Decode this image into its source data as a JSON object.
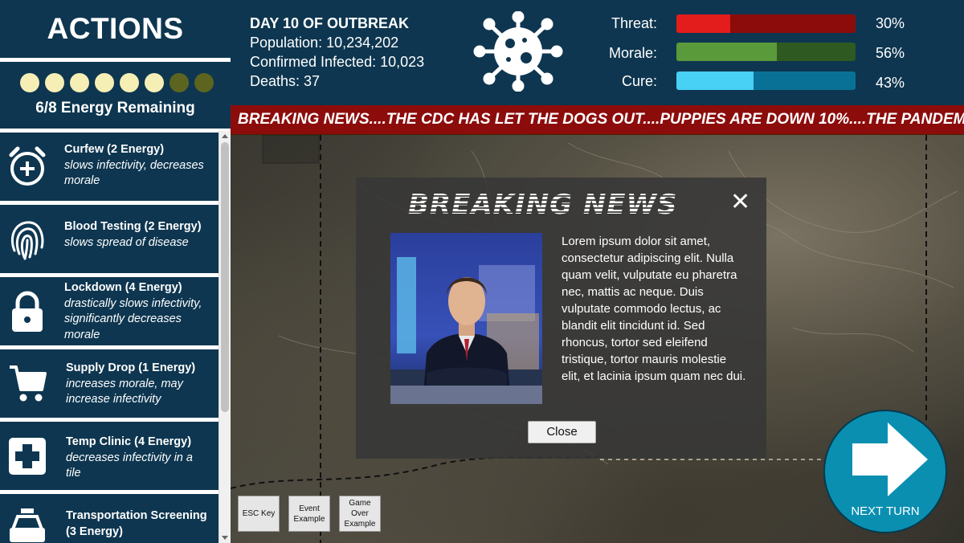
{
  "sidebar": {
    "title": "ACTIONS",
    "energy": {
      "total": 8,
      "remaining": 6,
      "label": "6/8 Energy Remaining"
    },
    "actions": [
      {
        "name": "Curfew (2 Energy)",
        "desc": "slows infectivity, decreases morale",
        "icon": "alarm-clock-plus-icon"
      },
      {
        "name": "Blood Testing (2 Energy)",
        "desc": "slows spread of disease",
        "icon": "fingerprint-icon"
      },
      {
        "name": "Lockdown (4 Energy)",
        "desc": "drastically slows infectivity, significantly decreases morale",
        "icon": "padlock-icon"
      },
      {
        "name": "Supply Drop (1 Energy)",
        "desc": "increases morale, may increase infectivity",
        "icon": "shopping-cart-icon"
      },
      {
        "name": "Temp Clinic (4 Energy)",
        "desc": "decreases infectivity in a tile",
        "icon": "medical-cross-icon"
      },
      {
        "name": "Transportation Screening (3 Energy)",
        "desc": "",
        "icon": "taxi-icon"
      }
    ]
  },
  "topbar": {
    "day": "DAY 10 OF OUTBREAK",
    "population": "Population: 10,234,202",
    "infected": "Confirmed Infected: 10,023",
    "deaths": "Deaths: 37",
    "meters": [
      {
        "label": "Threat:",
        "value": 30,
        "display": "30%",
        "color": "#e31c1c",
        "track": "#8c0c0c"
      },
      {
        "label": "Morale:",
        "value": 56,
        "display": "56%",
        "color": "#5a9a3a",
        "track": "#2e5a22"
      },
      {
        "label": "Cure:",
        "value": 43,
        "display": "43%",
        "color": "#48d0f5",
        "track": "#0a7196"
      }
    ]
  },
  "ticker": "BREAKING NEWS....THE CDC HAS LET THE DOGS OUT....PUPPIES ARE DOWN 10%....THE PANDEMIC",
  "modal": {
    "title": "BREAKING NEWS",
    "close_glyph": "✕",
    "body": "Lorem ipsum dolor sit amet, consectetur adipiscing elit. Nulla quam velit, vulputate eu pharetra nec, mattis ac neque. Duis vulputate commodo lectus, ac blandit elit tincidunt id. Sed rhoncus, tortor sed eleifend tristique, tortor mauris molestie elit, et lacinia ipsum quam nec dui.",
    "close_button": "Close"
  },
  "buttons": {
    "esc": "ESC Key",
    "event": "Event Example",
    "gameover": "Game Over Example",
    "next_turn": "NEXT TURN"
  }
}
